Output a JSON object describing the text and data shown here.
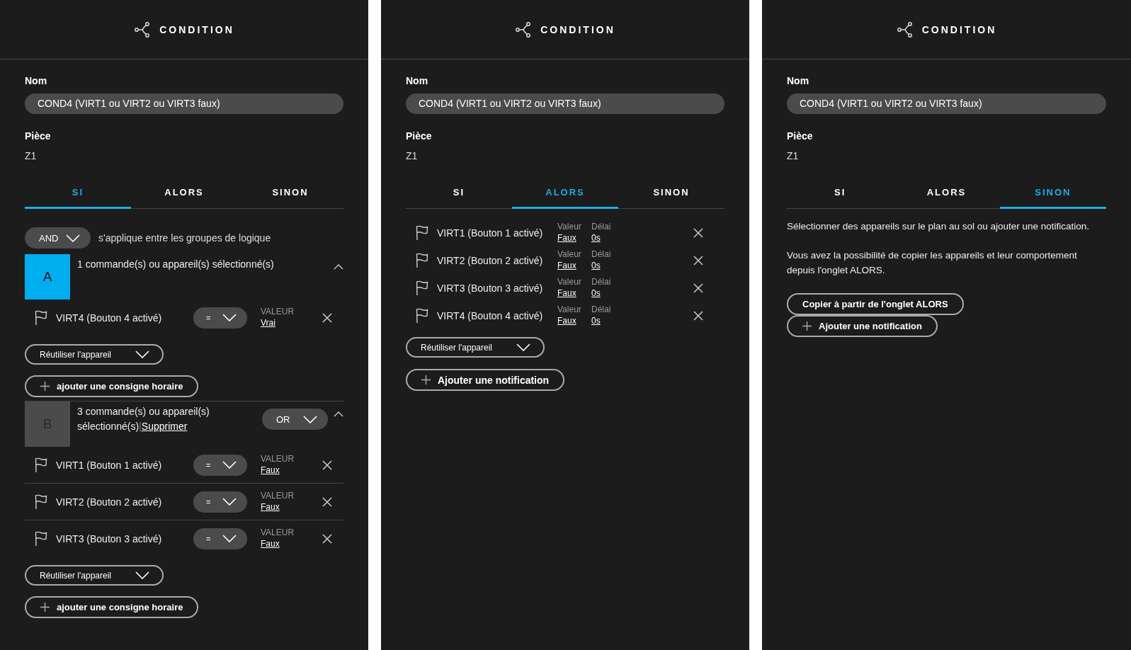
{
  "panels": [
    {
      "header": {
        "title": "CONDITION"
      },
      "name_label": "Nom",
      "name_value": "COND4 (VIRT1 ou VIRT2 ou VIRT3 faux)",
      "room_label": "Pièce",
      "room_value": "Z1",
      "tabs": [
        {
          "label": "SI",
          "selected": true
        },
        {
          "label": "ALORS",
          "selected": false
        },
        {
          "label": "SINON",
          "selected": false
        }
      ],
      "content": {
        "kind": "si",
        "logic": {
          "operator": "AND",
          "text": "s'applique entre les groupes de logique"
        },
        "groups": [
          {
            "letter": "A",
            "selected": true,
            "expanded": true,
            "summary": "1 commande(s) ou appareil(s) sélectionné(s)",
            "devices": [
              {
                "name": "VIRT4 (Bouton 4 activé)",
                "operator": "=",
                "value_label": "VALEUR",
                "value": "Vrai"
              }
            ],
            "reuse": "Réutiliser l'appareil",
            "add": "ajouter une consigne horaire"
          },
          {
            "letter": "B",
            "selected": false,
            "expanded": true,
            "summary": "3 commande(s) ou appareil(s) sélectionné(s)",
            "separator": "|",
            "delete": "Supprimer",
            "operator": "OR",
            "devices": [
              {
                "name": "VIRT1 (Bouton 1 activé)",
                "operator": "=",
                "value_label": "VALEUR",
                "value": "Faux"
              },
              {
                "name": "VIRT2 (Bouton 2 activé)",
                "operator": "=",
                "value_label": "VALEUR",
                "value": "Faux"
              },
              {
                "name": "VIRT3 (Bouton 3 activé)",
                "operator": "=",
                "value_label": "VALEUR",
                "value": "Faux"
              }
            ],
            "reuse": "Réutiliser l'appareil",
            "add": "ajouter une consigne horaire"
          }
        ]
      }
    },
    {
      "header": {
        "title": "CONDITION"
      },
      "name_label": "Nom",
      "name_value": "COND4 (VIRT1 ou VIRT2 ou VIRT3 faux)",
      "room_label": "Pièce",
      "room_value": "Z1",
      "tabs": [
        {
          "label": "SI",
          "selected": false
        },
        {
          "label": "ALORS",
          "selected": true
        },
        {
          "label": "SINON",
          "selected": false
        }
      ],
      "content": {
        "kind": "alors",
        "devices": [
          {
            "name": "VIRT1 (Bouton 1 activé)",
            "value_label": "Valeur",
            "value": "Faux",
            "delay_label": "Délai",
            "delay": "0s"
          },
          {
            "name": "VIRT2 (Bouton 2 activé)",
            "value_label": "Valeur",
            "value": "Faux",
            "delay_label": "Délai",
            "delay": "0s"
          },
          {
            "name": "VIRT3 (Bouton 3 activé)",
            "value_label": "Valeur",
            "value": "Faux",
            "delay_label": "Délai",
            "delay": "0s"
          },
          {
            "name": "VIRT4 (Bouton 4 activé)",
            "value_label": "Valeur",
            "value": "Faux",
            "delay_label": "Délai",
            "delay": "0s"
          }
        ],
        "reuse": "Réutiliser l'appareil",
        "add": "Ajouter une notification"
      }
    },
    {
      "header": {
        "title": "CONDITION"
      },
      "name_label": "Nom",
      "name_value": "COND4 (VIRT1 ou VIRT2 ou VIRT3 faux)",
      "room_label": "Pièce",
      "room_value": "Z1",
      "tabs": [
        {
          "label": "SI",
          "selected": false
        },
        {
          "label": "ALORS",
          "selected": false
        },
        {
          "label": "SINON",
          "selected": true
        }
      ],
      "content": {
        "kind": "sinon",
        "paragraphs": [
          "Sélectionner des appareils sur le plan au sol ou ajouter une notification.",
          "Vous avez la possibilité de copier les appareils et leur comportement depuis l'onglet ALORS."
        ],
        "buttons": [
          {
            "label": "Copier à partir de l'onglet ALORS",
            "kind": "plain"
          },
          {
            "label": "Ajouter une notification",
            "kind": "add"
          }
        ]
      }
    }
  ]
}
